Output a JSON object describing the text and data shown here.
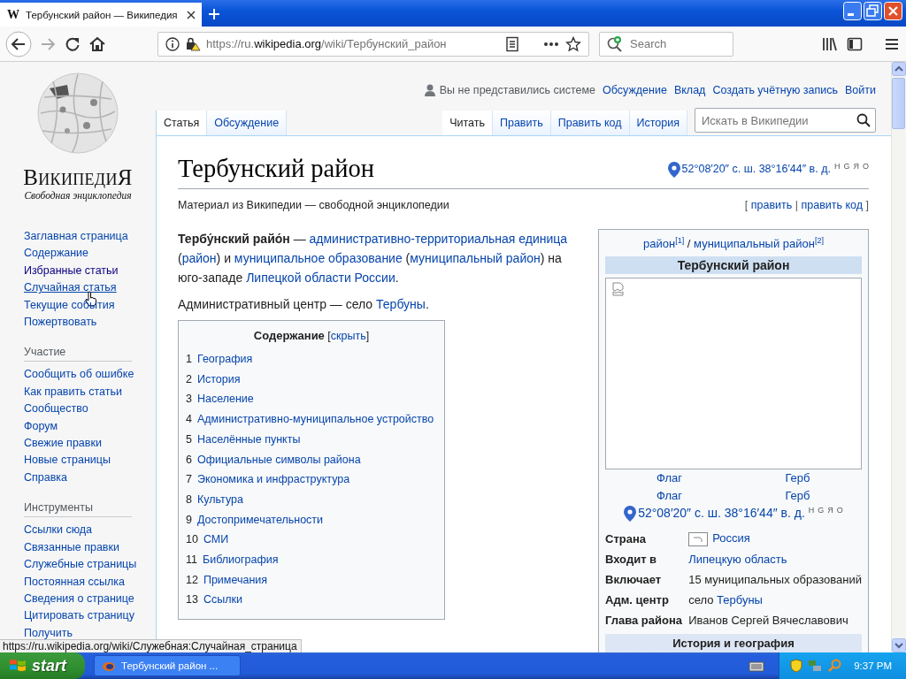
{
  "browser": {
    "favicon_glyph": "W",
    "tab_title": "Тербунский район — Википедия",
    "url": {
      "prefix": "https://ru.",
      "host": "wikipedia.org",
      "path": "/wiki/Тербунский_район"
    },
    "search_placeholder": "Search"
  },
  "user_links": [
    {
      "label": "Вы не представились системе",
      "kind": "status"
    },
    {
      "label": "Обсуждение",
      "kind": "link"
    },
    {
      "label": "Вклад",
      "kind": "link"
    },
    {
      "label": "Создать учётную запись",
      "kind": "link"
    },
    {
      "label": "Войти",
      "kind": "link"
    }
  ],
  "logo": {
    "wordmark": "ВикипедиЯ",
    "tagline": "Свободная энциклопедия"
  },
  "sidebar": {
    "groups": [
      {
        "items": [
          {
            "label": "Заглавная страница",
            "visited": false,
            "hovered": false
          },
          {
            "label": "Содержание",
            "visited": false,
            "hovered": false
          },
          {
            "label": "Избранные статьи",
            "visited": true,
            "hovered": false
          },
          {
            "label": "Случайная статья",
            "visited": false,
            "hovered": true
          },
          {
            "label": "Текущие события",
            "visited": false,
            "hovered": false
          },
          {
            "label": "Пожертвовать",
            "visited": false,
            "hovered": false
          }
        ]
      },
      {
        "heading": "Участие",
        "items": [
          {
            "label": "Сообщить об ошибке",
            "visited": false,
            "hovered": false
          },
          {
            "label": "Как править статьи",
            "visited": false,
            "hovered": false
          },
          {
            "label": "Сообщество",
            "visited": false,
            "hovered": false
          },
          {
            "label": "Форум",
            "visited": false,
            "hovered": false
          },
          {
            "label": "Свежие правки",
            "visited": false,
            "hovered": false
          },
          {
            "label": "Новые страницы",
            "visited": false,
            "hovered": false
          },
          {
            "label": "Справка",
            "visited": false,
            "hovered": false
          }
        ]
      },
      {
        "heading": "Инструменты",
        "items": [
          {
            "label": "Ссылки сюда",
            "visited": false,
            "hovered": false
          },
          {
            "label": "Связанные правки",
            "visited": false,
            "hovered": false
          },
          {
            "label": "Служебные страницы",
            "visited": false,
            "hovered": false
          },
          {
            "label": "Постоянная ссылка",
            "visited": false,
            "hovered": false
          },
          {
            "label": "Сведения о странице",
            "visited": false,
            "hovered": false
          },
          {
            "label": "Цитировать страницу",
            "visited": false,
            "hovered": false
          },
          {
            "label": "Получить",
            "visited": false,
            "hovered": false
          }
        ]
      }
    ]
  },
  "namespace_tabs": [
    {
      "label": "Статья",
      "selected": true
    },
    {
      "label": "Обсуждение",
      "selected": false
    }
  ],
  "view_tabs": [
    {
      "label": "Читать",
      "selected": true
    },
    {
      "label": "Править",
      "selected": false
    },
    {
      "label": "Править код",
      "selected": false
    },
    {
      "label": "История",
      "selected": false
    }
  ],
  "wiki_search": {
    "placeholder": "Искать в Википедии"
  },
  "article": {
    "title": "Тербунский район",
    "coordinates": "52°08′20″ с. ш. 38°16′44″ в. д.",
    "coord_links": [
      "H",
      "G",
      "Я",
      "O"
    ],
    "tagline": "Материал из Википедии — свободной энциклопедии",
    "edit_links": {
      "open": "[",
      "items": [
        "править",
        "править код"
      ],
      "separator": "|",
      "close": "]"
    },
    "paragraphs": [
      [
        {
          "text": "Тербу́нский райо́н",
          "kind": "bold"
        },
        {
          "text": " — ",
          "kind": "plain"
        },
        {
          "text": "административно-территориальная единица",
          "kind": "link"
        },
        {
          "text": " (",
          "kind": "plain"
        },
        {
          "text": "район",
          "kind": "link"
        },
        {
          "text": ") и ",
          "kind": "plain"
        },
        {
          "text": "муниципальное образование",
          "kind": "link"
        },
        {
          "text": " (",
          "kind": "plain"
        },
        {
          "text": "муниципальный район",
          "kind": "link"
        },
        {
          "text": ") на юго-западе ",
          "kind": "plain"
        },
        {
          "text": "Липецкой области России",
          "kind": "link"
        },
        {
          "text": ".",
          "kind": "plain"
        }
      ],
      [
        {
          "text": "Административный центр — село ",
          "kind": "plain"
        },
        {
          "text": "Тербуны",
          "kind": "link"
        },
        {
          "text": ".",
          "kind": "plain"
        }
      ]
    ]
  },
  "toc": {
    "title": "Содержание",
    "toggle_open": "[",
    "toggle": "скрыть",
    "toggle_close": "]",
    "items": [
      {
        "number": "1",
        "label": "География"
      },
      {
        "number": "2",
        "label": "История"
      },
      {
        "number": "3",
        "label": "Население"
      },
      {
        "number": "4",
        "label": "Административно-муниципальное устройство"
      },
      {
        "number": "5",
        "label": "Населённые пункты"
      },
      {
        "number": "6",
        "label": "Официальные символы района"
      },
      {
        "number": "7",
        "label": "Экономика и инфраструктура"
      },
      {
        "number": "8",
        "label": "Культура"
      },
      {
        "number": "9",
        "label": "Достопримечательности"
      },
      {
        "number": "10",
        "label": "СМИ"
      },
      {
        "number": "11",
        "label": "Библиография"
      },
      {
        "number": "12",
        "label": "Примечания"
      },
      {
        "number": "13",
        "label": "Ссылки"
      }
    ]
  },
  "infobox": {
    "type_links": [
      "район$^{[1]}$",
      "муниципальный район$^{[2]}$"
    ],
    "type_separator": "/",
    "title": "Тербунский район",
    "symbols": [
      {
        "left": "Флаг",
        "right": "Герб"
      },
      {
        "left": "Флаг",
        "right": "Герб"
      }
    ],
    "coordinates": "52°08′20″ с. ш. 38°16′44″ в. д.",
    "coord_links": [
      "H",
      "G",
      "Я",
      "O"
    ],
    "rows": [
      {
        "label": "Страна",
        "kind": "with-icon",
        "value": [
          {
            "text": "Россия",
            "kind": "link"
          }
        ]
      },
      {
        "label": "Входит в",
        "kind": "plain",
        "value": [
          {
            "text": "Липецкую область",
            "kind": "link"
          }
        ]
      },
      {
        "label": "Включает",
        "kind": "plain",
        "value": [
          {
            "text": "15 муниципальных образований",
            "kind": "plain"
          }
        ]
      },
      {
        "label": "Адм. центр",
        "kind": "plain",
        "value": [
          {
            "text": "село ",
            "kind": "plain"
          },
          {
            "text": "Тербуны",
            "kind": "link"
          }
        ]
      },
      {
        "label": "Глава района",
        "kind": "plain",
        "value": [
          {
            "text": "Иванов Сергей Вячеславович",
            "kind": "plain"
          }
        ]
      }
    ],
    "section": "История и география"
  },
  "status_url": "https://ru.wikipedia.org/wiki/Служебная:Случайная_страница",
  "taskbar": {
    "start": "start",
    "tasks": [
      {
        "label": "Тербунский район ..."
      }
    ],
    "clock": "9:37 PM"
  }
}
